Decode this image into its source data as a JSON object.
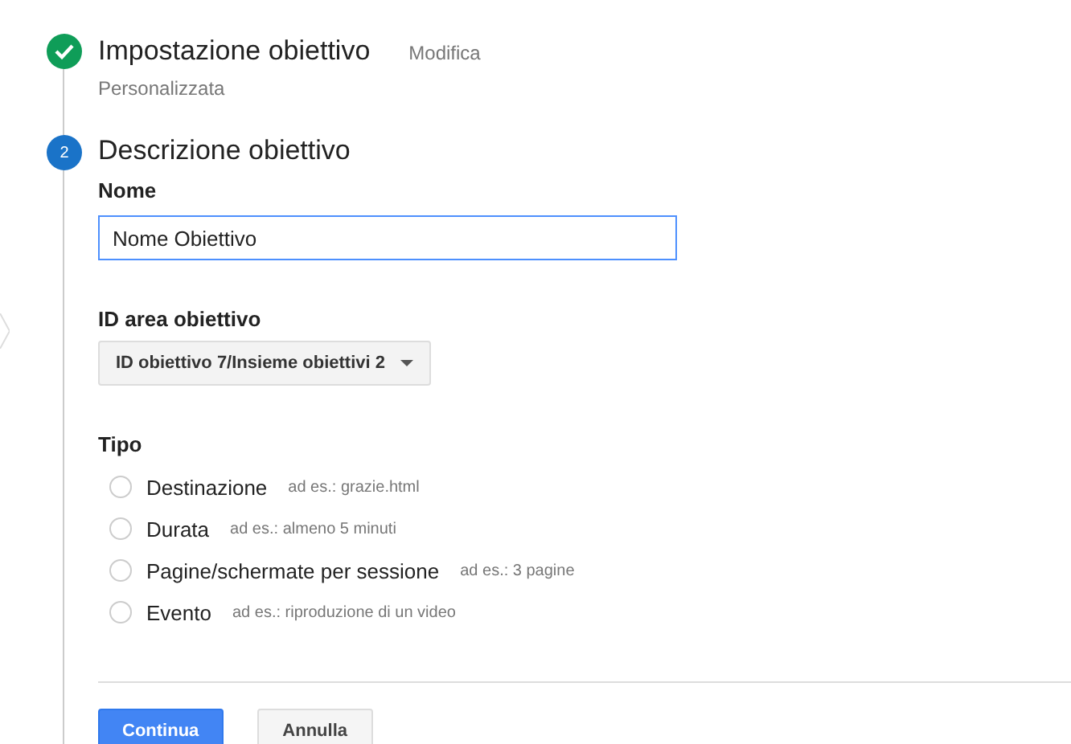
{
  "steps": [
    {
      "kind": "done",
      "title": "Impostazione obiettivo",
      "action": "Modifica",
      "summary": "Personalizzata"
    },
    {
      "kind": "current",
      "number": "2",
      "title": "Descrizione obiettivo"
    }
  ],
  "name_field": {
    "label": "Nome",
    "value": "Nome Obiettivo"
  },
  "goal_slot": {
    "label": "ID area obiettivo",
    "value": "ID obiettivo 7/Insieme obiettivi 2"
  },
  "type": {
    "label": "Tipo",
    "options": [
      {
        "label": "Destinazione",
        "hint": "ad es.: grazie.html",
        "selected": false
      },
      {
        "label": "Durata",
        "hint": "ad es.: almeno 5 minuti",
        "selected": false
      },
      {
        "label": "Pagine/schermate per sessione",
        "hint": "ad es.: 3 pagine",
        "selected": false
      },
      {
        "label": "Evento",
        "hint": "ad es.: riproduzione di un video",
        "selected": false
      }
    ]
  },
  "buttons": [
    {
      "label": "Continua",
      "kind": "primary"
    },
    {
      "label": "Annulla",
      "kind": "secondary"
    }
  ]
}
